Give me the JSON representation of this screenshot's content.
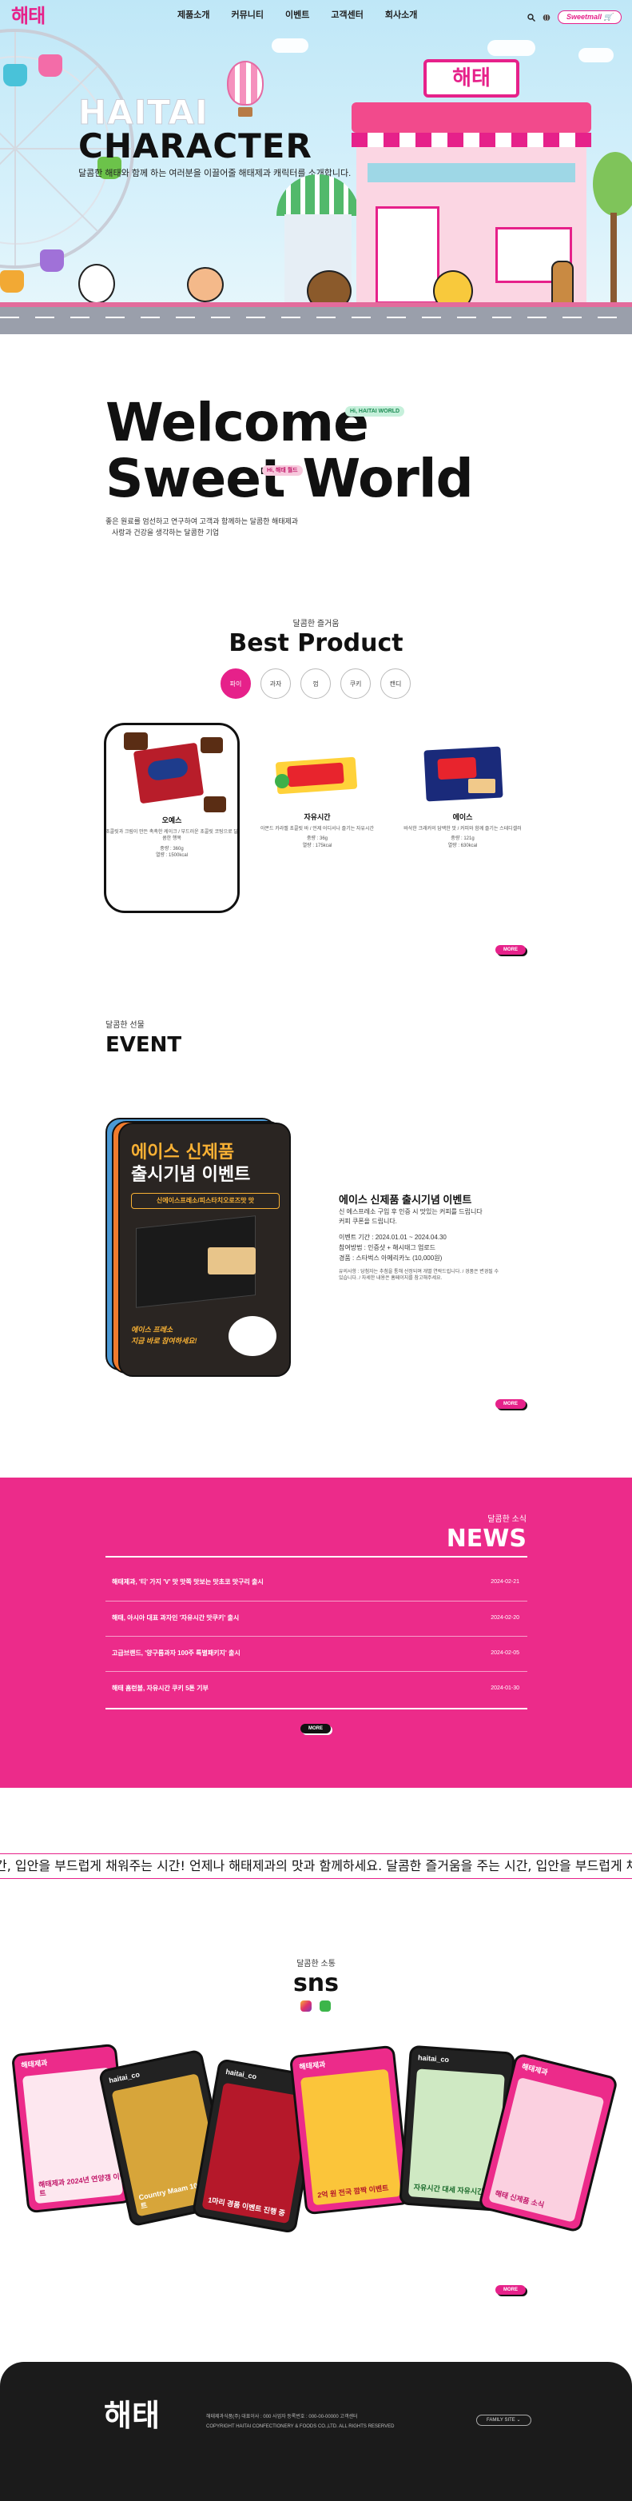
{
  "header": {
    "logo": "해태",
    "nav": [
      "제품소개",
      "커뮤니티",
      "이벤트",
      "고객센터",
      "회사소개"
    ],
    "mall_label": "Sweetmall",
    "icons": [
      "search-icon",
      "globe-icon",
      "cart-icon"
    ]
  },
  "hero": {
    "title_line1": "HAITAI",
    "title_line2": "CHARACTER",
    "subtitle": "달콤한 해태와 함께 하는 여러분을 이끌어줄 해태제과 캐릭터를 소개합니다.",
    "shop_sign": "해태"
  },
  "welcome": {
    "line1": "Welcome",
    "line2": "Sweet World",
    "tag1": "Hi, HAITAI WORLD",
    "tag2": "Hi, 해태 월드",
    "text1": "좋은 원료를 엄선하고 연구하여 고객과 함께하는 달콤한 해태제과",
    "text2": "사랑과 건강을 생각하는 달콤한 기업"
  },
  "best": {
    "subtitle": "달콤한 즐거움",
    "title": "Best Product",
    "tabs": [
      "파이",
      "과자",
      "껌",
      "쿠키",
      "캔디"
    ],
    "active_tab": 0,
    "more": "MORE",
    "products": [
      {
        "name": "오예스",
        "desc": "초콜릿과 크림이 만든 촉촉한 케이크 / 부드러운 초콜릿 코팅으로 달콤한 행복",
        "meta1": "중량 : 360g",
        "meta2": "열량 : 1500kcal"
      },
      {
        "name": "자유시간",
        "desc": "아몬드 카라멜 초콜릿 바 / 언제 어디서나 즐기는 자유시간",
        "meta1": "중량 : 36g",
        "meta2": "열량 : 175kcal"
      },
      {
        "name": "에이스",
        "desc": "바삭한 크래커의 담백한 맛 / 커피와 함께 즐기는 스테디셀러",
        "meta1": "중량 : 121g",
        "meta2": "열량 : 630kcal"
      }
    ]
  },
  "event": {
    "subtitle": "달콤한 선물",
    "title": "EVENT",
    "poster_line1": "에이스 신제품",
    "poster_line2": "출시기념 이벤트",
    "poster_line3": "신에이스프레소/피스타치오로즈맛 맛",
    "poster_line4": "에이스 프레소",
    "poster_line5": "지금 바로 참여하세요!",
    "name": "에이스 신제품 출시기념 이벤트",
    "desc1": "신 에스프레소 구입 후 인증 시 맛있는 커피를 드립니다",
    "desc2": "커피 쿠폰을 드립니다.",
    "period": "이벤트 기간 : 2024.01.01 ~ 2024.04.30",
    "method": "참여방법 : 인증샷 + 해시태그 업로드",
    "prize": "경품 : 스타벅스 아메리카노 (10,000원)",
    "notes": "유의사항 : 당첨자는 추첨을 통해 선정되며 개별 연락드립니다. / 경품은 변경될 수 있습니다. / 자세한 내용은 홈페이지를 참고해주세요.",
    "more": "MORE"
  },
  "news": {
    "subtitle": "달콤한 소식",
    "title": "NEWS",
    "items": [
      {
        "title": "해태제과, '티' 가지 'V' 맛 맛쪽 맛보는 맛초코 맛구리 출시",
        "date": "2024-02-21"
      },
      {
        "title": "해태, 아시아 대표 과자인 '자유시간 맛쿠키' 출시",
        "date": "2024-02-20"
      },
      {
        "title": "고급브랜드, '양구름과자 100주 특별패키지' 출시",
        "date": "2024-02-05"
      },
      {
        "title": "해태 홈런볼, 자유시간 쿠키 5톤 기부",
        "date": "2024-01-30"
      }
    ],
    "more": "MORE"
  },
  "marquee": "간, 입안을 부드럽게 채워주는 시간! 언제나 해태제과의 맛과 함께하세요. 달콤한 즐거움을 주는 시간, 입안을 부드럽게 채워주는 시",
  "sns": {
    "subtitle": "달콤한 소통",
    "title": "sns",
    "more": "MORE",
    "cards": [
      {
        "handle": "해태제과",
        "text": "해태제과 2024년 연양갱 이벤트"
      },
      {
        "handle": "haitai_co",
        "text": "Country Maam 100주 이벤트"
      },
      {
        "handle": "haitai_co",
        "text": "1마리 경품 이벤트 진행 중"
      },
      {
        "handle": "해태제과",
        "text": "2억 원 전국 깜짝 이벤트"
      },
      {
        "handle": "haitai_co",
        "text": "자유시간 대세 자유시간"
      },
      {
        "handle": "해태제과",
        "text": "해태 신제품 소식"
      }
    ]
  },
  "footer": {
    "logo": "해태",
    "line1": "해태제과식품(주)   대표이사 : 000   사업자 등록번호 : 000-00-00000   고객센터",
    "line2": "COPYRIGHT HAITAI CONFECTIONERY & FOODS CO.,LTD. ALL RIGHTS RESERVED",
    "family_site": "FAMILY SITE"
  }
}
